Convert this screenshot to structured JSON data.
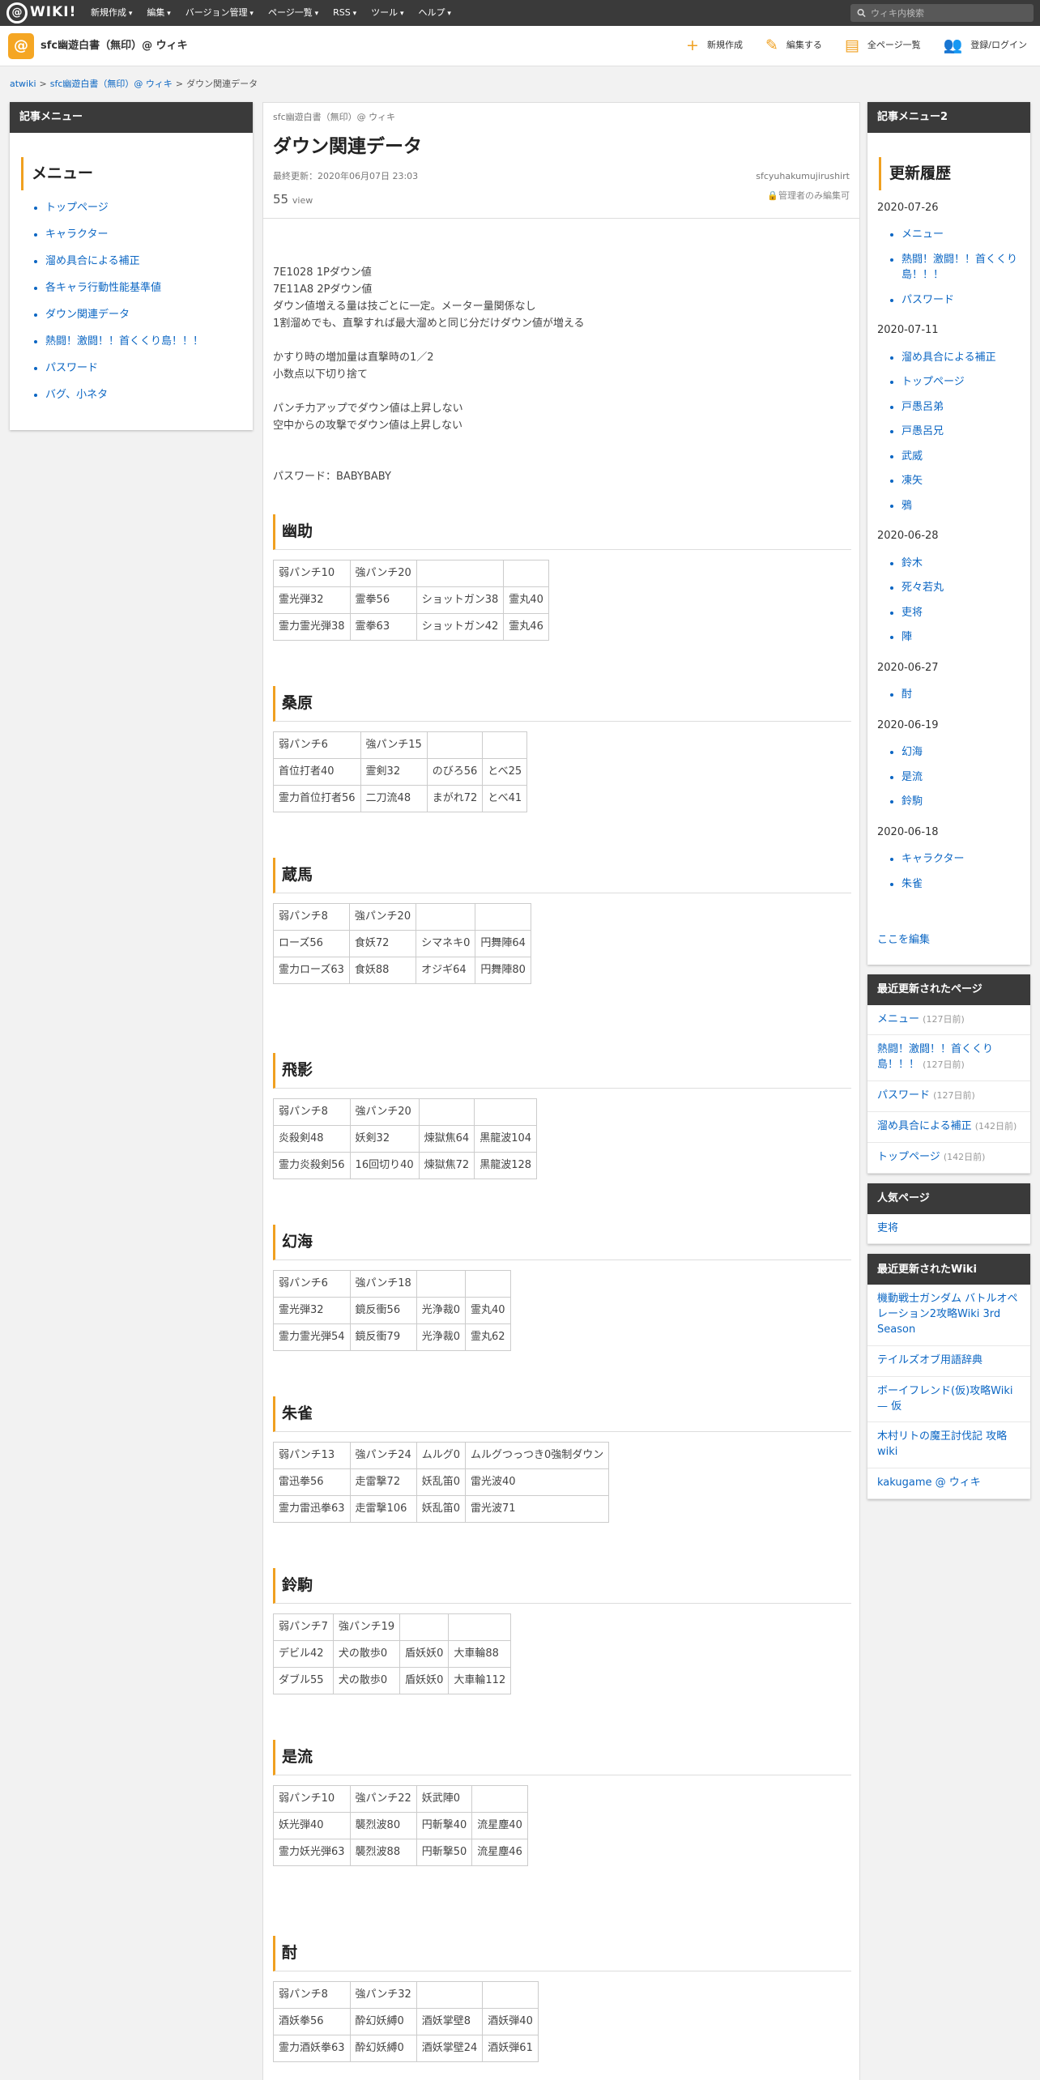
{
  "topbar": {
    "logo": "WIKI!",
    "menu": [
      "新規作成",
      "編集",
      "バージョン管理",
      "ページ一覧",
      "RSS",
      "ツール",
      "ヘルプ"
    ],
    "search_placeholder": "ウィキ内検索"
  },
  "site": {
    "title": "sfc幽遊白書（無印）@ ウィキ",
    "actions": [
      {
        "label": "新規作成",
        "icon": "plus-icon"
      },
      {
        "label": "編集する",
        "icon": "pencil-icon"
      },
      {
        "label": "全ページ一覧",
        "icon": "page-list-icon"
      },
      {
        "label": "登録/ログイン",
        "icon": "user-add-icon"
      }
    ]
  },
  "breadcrumb": [
    "atwiki",
    "sfc幽遊白書（無印）@ ウィキ",
    "ダウン関連データ"
  ],
  "left": {
    "panel_title": "記事メニュー",
    "menu_heading": "メニュー",
    "items": [
      "トップページ",
      "キャラクター",
      "溜め具合による補正",
      "各キャラ行動性能基準値",
      "ダウン関連データ",
      "熱闘！激闘！！首くくり島！！！",
      "パスワード",
      "バグ、小ネタ"
    ]
  },
  "main": {
    "site_small": "sfc幽遊白書（無印）@ ウィキ",
    "title": "ダウン関連データ",
    "last_update": "最終更新：2020年06月07日 23:03",
    "author": "sfcyuhakumujirushirt",
    "views_num": "55",
    "views_label": "view",
    "lock_text": "管理者のみ編集可",
    "lines": [
      [
        "7E1028 1Pダウン値",
        "7E11A8 2Pダウン値",
        "ダウン値増える量は技ごとに一定。メーター量関係なし",
        "1割溜めでも、直撃すれば最大溜めと同じ分だけダウン値が増える"
      ],
      [
        "かすり時の増加量は直撃時の1／2",
        "小数点以下切り捨て"
      ],
      [
        "パンチ力アップでダウン値は上昇しない",
        "空中からの攻撃でダウン値は上昇しない"
      ],
      [
        "パスワード：BABYBABY"
      ]
    ],
    "sections": [
      {
        "name": "幽助",
        "rows": [
          [
            "弱パンチ10",
            "強パンチ20",
            "",
            ""
          ],
          [
            "霊光弾32",
            "霊拳56",
            "ショットガン38",
            "霊丸40"
          ],
          [
            "霊力霊光弾38",
            "霊拳63",
            "ショットガン42",
            "霊丸46"
          ]
        ]
      },
      {
        "name": "桑原",
        "rows": [
          [
            "弱パンチ6",
            "強パンチ15",
            "",
            ""
          ],
          [
            "首位打者40",
            "霊剣32",
            "のびろ56",
            "とべ25"
          ],
          [
            "霊力首位打者56",
            "二刀流48",
            "まがれ72",
            "とべ41"
          ]
        ]
      },
      {
        "name": "蔵馬",
        "rows": [
          [
            "弱パンチ8",
            "強パンチ20",
            "",
            ""
          ],
          [
            "ローズ56",
            "食妖72",
            "シマネキ0",
            "円舞陣64"
          ],
          [
            "霊力ローズ63",
            "食妖88",
            "オジギ64",
            "円舞陣80"
          ]
        ]
      },
      {
        "name": "飛影",
        "rows": [
          [
            "弱パンチ8",
            "強パンチ20",
            "",
            ""
          ],
          [
            "炎殺剣48",
            "妖剣32",
            "煉獄焦64",
            "黒龍波104"
          ],
          [
            "霊力炎殺剣56",
            "16回切り40",
            "煉獄焦72",
            "黒龍波128"
          ]
        ]
      },
      {
        "name": "幻海",
        "rows": [
          [
            "弱パンチ6",
            "強パンチ18",
            "",
            ""
          ],
          [
            "霊光弾32",
            "鏡反衝56",
            "光浄裁0",
            "霊丸40"
          ],
          [
            "霊力霊光弾54",
            "鏡反衝79",
            "光浄裁0",
            "霊丸62"
          ]
        ]
      },
      {
        "name": "朱雀",
        "rows": [
          [
            "弱パンチ13",
            "強パンチ24",
            "ムルグ0",
            "ムルグつっつき0強制ダウン"
          ],
          [
            "雷迅拳56",
            "走雷撃72",
            "妖乱笛0",
            "雷光波40"
          ],
          [
            "霊力雷迅拳63",
            "走雷撃106",
            "妖乱笛0",
            "雷光波71"
          ]
        ]
      },
      {
        "name": "鈴駒",
        "rows": [
          [
            "弱パンチ7",
            "強パンチ19",
            "",
            ""
          ],
          [
            "デビル42",
            "犬の散歩0",
            "盾妖妖0",
            "大車輪88"
          ],
          [
            "ダブル55",
            "犬の散歩0",
            "盾妖妖0",
            "大車輪112"
          ]
        ]
      },
      {
        "name": "是流",
        "rows": [
          [
            "弱パンチ10",
            "強パンチ22",
            "妖武陣0",
            ""
          ],
          [
            "妖光弾40",
            "襲烈波80",
            "円斬撃40",
            "流星塵40"
          ],
          [
            "霊力妖光弾63",
            "襲烈波88",
            "円斬撃50",
            "流星塵46"
          ]
        ]
      },
      {
        "name": "酎",
        "rows": [
          [
            "弱パンチ8",
            "強パンチ32",
            "",
            ""
          ],
          [
            "酒妖拳56",
            "酔幻妖縛0",
            "酒妖掌壁8",
            "酒妖弾40"
          ],
          [
            "霊力酒妖拳63",
            "酔幻妖縛0",
            "酒妖掌壁24",
            "酒妖弾61"
          ]
        ]
      }
    ]
  },
  "right": {
    "panel2_title": "記事メニュー2",
    "history_heading": "更新履歴",
    "history": [
      {
        "date": "2020-07-26",
        "items": [
          "メニュー",
          "熱闘！激闘！！首くくり島！！！",
          "パスワード"
        ]
      },
      {
        "date": "2020-07-11",
        "items": [
          "溜め具合による補正",
          "トップページ",
          "戸愚呂弟",
          "戸愚呂兄",
          "武威",
          "凍矢",
          "鴉"
        ]
      },
      {
        "date": "2020-06-28",
        "items": [
          "鈴木",
          "死々若丸",
          "吏将",
          "陣"
        ]
      },
      {
        "date": "2020-06-27",
        "items": [
          "酎"
        ]
      },
      {
        "date": "2020-06-19",
        "items": [
          "幻海",
          "是流",
          "鈴駒"
        ]
      },
      {
        "date": "2020-06-18",
        "items": [
          "キャラクター",
          "朱雀"
        ]
      }
    ],
    "edit_link": "ここを編集",
    "recent_title": "最近更新されたページ",
    "recent": [
      {
        "label": "メニュー",
        "ago": "(127日前)"
      },
      {
        "label": "熱闘！激闘！！首くくり島！！！",
        "ago": "(127日前)"
      },
      {
        "label": "パスワード",
        "ago": "(127日前)"
      },
      {
        "label": "溜め具合による補正",
        "ago": "(142日前)"
      },
      {
        "label": "トップページ",
        "ago": "(142日前)"
      }
    ],
    "popular_title": "人気ページ",
    "popular": [
      "吏将"
    ],
    "wiki_title": "最近更新されたWiki",
    "wikis": [
      "機動戦士ガンダム バトルオペレーション2攻略Wiki 3rd Season",
      "テイルズオブ用語辞典",
      "ボーイフレンド(仮)攻略Wiki — 仮",
      "木村リトの魔王討伐記 攻略wiki",
      "kakugame @ ウィキ"
    ]
  }
}
